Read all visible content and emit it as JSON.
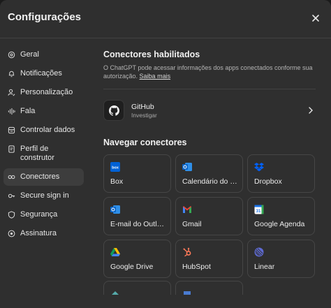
{
  "header": {
    "title": "Configurações"
  },
  "sidebar": {
    "items": [
      {
        "label": "Geral",
        "icon": "gear-icon"
      },
      {
        "label": "Notificações",
        "icon": "bell-icon"
      },
      {
        "label": "Personalização",
        "icon": "user-edit-icon"
      },
      {
        "label": "Fala",
        "icon": "waveform-icon"
      },
      {
        "label": "Controlar dados",
        "icon": "database-icon"
      },
      {
        "label": "Perfil de construtor",
        "icon": "id-card-icon"
      },
      {
        "label": "Conectores",
        "icon": "connectors-icon",
        "active": true
      },
      {
        "label": "Secure sign in",
        "icon": "key-icon"
      },
      {
        "label": "Segurança",
        "icon": "shield-icon"
      },
      {
        "label": "Assinatura",
        "icon": "badge-icon"
      }
    ]
  },
  "enabled": {
    "title": "Conectores habilitados",
    "description": "O ChatGPT pode acessar informações dos apps conectados conforme sua autorização.",
    "learn_more": "Saiba mais",
    "github": {
      "name": "GitHub",
      "subtitle": "Investigar",
      "icon": "github-icon"
    }
  },
  "browse": {
    "title": "Navegar conectores",
    "cards": [
      {
        "label": "Box",
        "icon": "box-icon",
        "color": "#0061d5"
      },
      {
        "label": "Calendário do Outlook",
        "icon": "outlook-calendar-icon",
        "color": "#0a64c8"
      },
      {
        "label": "Dropbox",
        "icon": "dropbox-icon",
        "color": "#0061fe"
      },
      {
        "label": "E-mail do Outlook",
        "icon": "outlook-mail-icon",
        "color": "#0a64c8"
      },
      {
        "label": "Gmail",
        "icon": "gmail-icon",
        "color": "#ea4335"
      },
      {
        "label": "Google Agenda",
        "icon": "google-calendar-icon",
        "color": "#1a73e8"
      },
      {
        "label": "Google Drive",
        "icon": "google-drive-icon",
        "color": "#34a853"
      },
      {
        "label": "HubSpot",
        "icon": "hubspot-icon",
        "color": "#ff7a59"
      },
      {
        "label": "Linear",
        "icon": "linear-icon",
        "color": "#5e6ad2"
      }
    ]
  }
}
